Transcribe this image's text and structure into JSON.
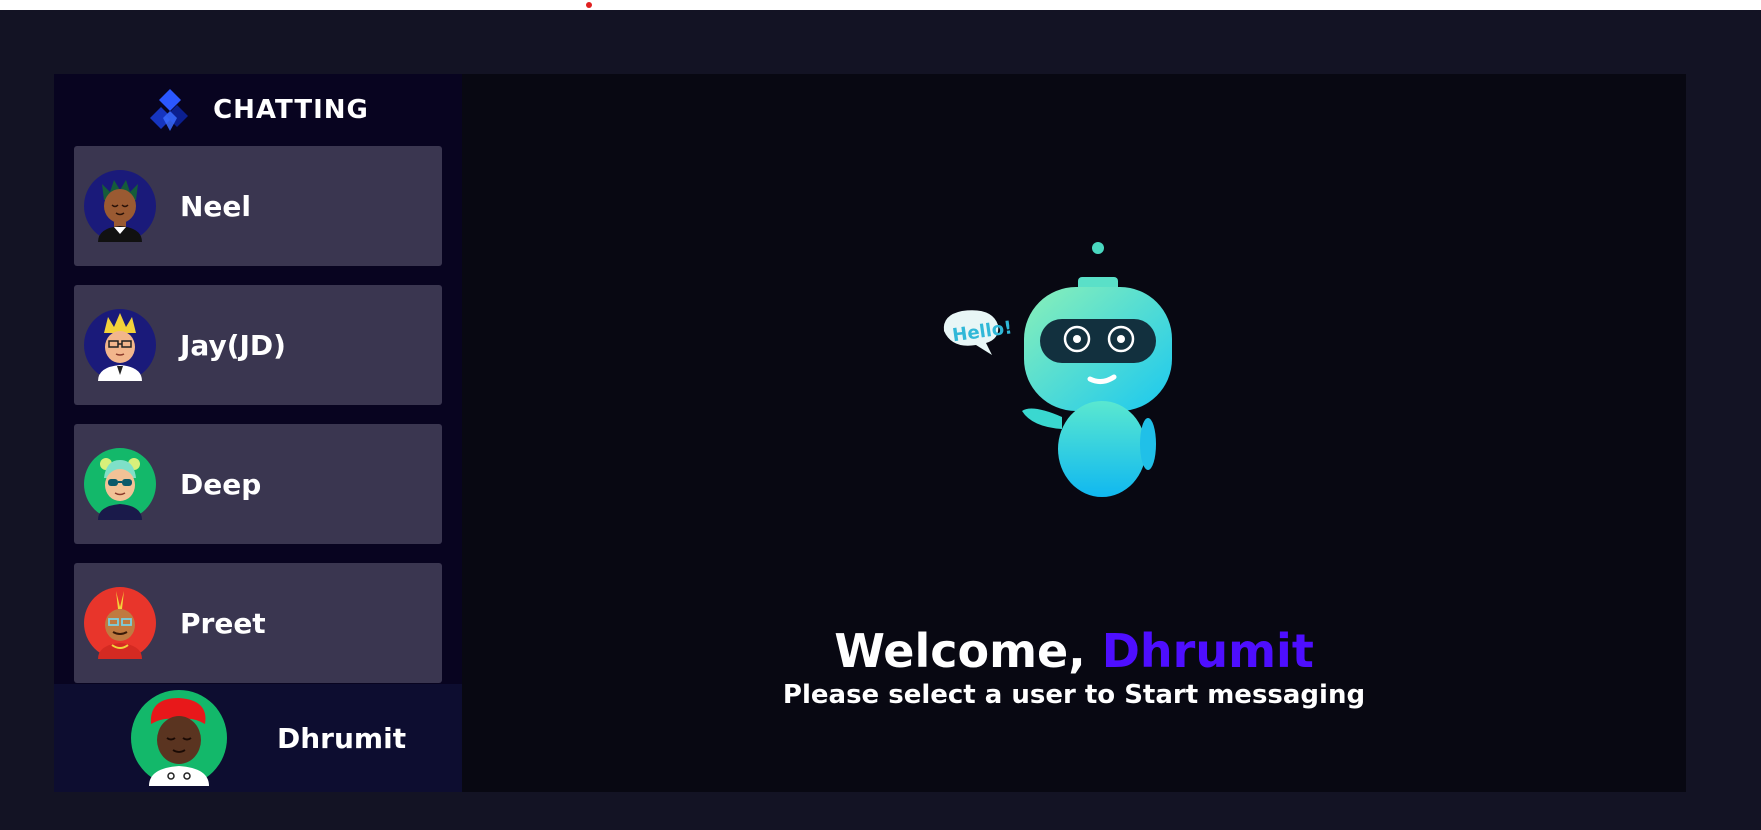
{
  "brand": {
    "title": "CHATTING",
    "logo_icon": "diamond-stack-logo-icon",
    "logo_colors": [
      "#1a3fd6",
      "#0a1fa0"
    ]
  },
  "contacts": [
    {
      "name": "Neel",
      "avatar_icon": "avatar-icon",
      "avatar_bg": "#1a1a7a"
    },
    {
      "name": "Jay(JD)",
      "avatar_icon": "avatar-icon",
      "avatar_bg": "#1a1a7a"
    },
    {
      "name": "Deep",
      "avatar_icon": "avatar-icon",
      "avatar_bg": "#13b86a"
    },
    {
      "name": "Preet",
      "avatar_icon": "avatar-icon",
      "avatar_bg": "#e8352b"
    }
  ],
  "current_user": {
    "name": "Dhrumit",
    "avatar_icon": "avatar-icon",
    "avatar_bg": "#13b86a"
  },
  "welcome": {
    "greeting": "Welcome, ",
    "username": "Dhrumit",
    "subtitle": "Please select a user to Start messaging",
    "robot_bubble": "Hello!"
  },
  "colors": {
    "page_bg": "#131324",
    "sidebar_bg": "#080420",
    "contact_bg": "#3a3650",
    "current_user_bg": "#0d0d30",
    "accent": "#4e0eff"
  }
}
